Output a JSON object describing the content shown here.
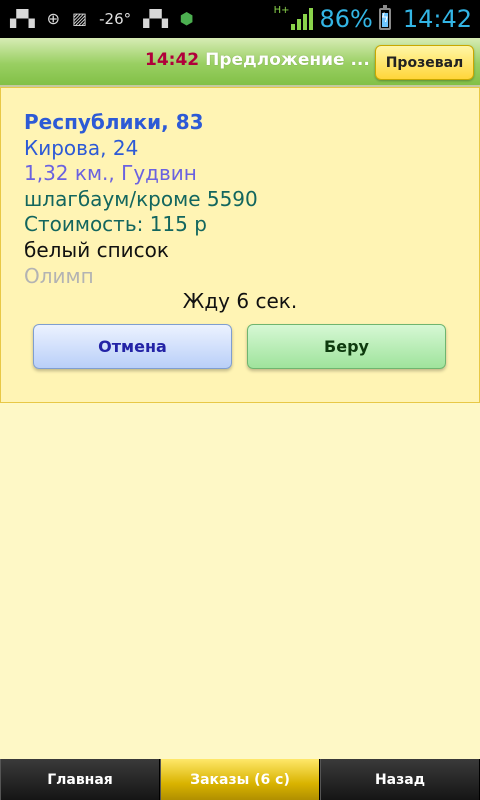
{
  "status_bar": {
    "temperature": "-26°",
    "network_type": "H+",
    "battery_percent": "86%",
    "time": "14:42",
    "icons": [
      "taxi-icon",
      "gps-icon",
      "image-icon",
      "taxi-icon",
      "shield-app-icon",
      "signal-icon",
      "battery-icon"
    ]
  },
  "title_bar": {
    "time": "14:42",
    "message": "Предложение ...",
    "missed_button_label": "Прозевал"
  },
  "order": {
    "pickup": "Республики, 83",
    "destination": "Кирова, 24",
    "distance_info": "1,32 км., Гудвин",
    "note": "шлагбаум/кроме 5590",
    "price": "Стоимость: 115 р",
    "list_status": "белый список",
    "client": "Олимп",
    "wait_text": "Жду 6 сек.",
    "cancel_label": "Отмена",
    "accept_label": "Беру"
  },
  "bottom_nav": {
    "tabs": [
      {
        "label": "Главная",
        "active": false
      },
      {
        "label": "Заказы (6 с)",
        "active": true
      },
      {
        "label": "Назад",
        "active": false
      }
    ]
  },
  "colors": {
    "background": "#fef8c6",
    "status_accent": "#33b5e5",
    "title_green": "#99cf62",
    "active_tab": "#d9b300"
  }
}
